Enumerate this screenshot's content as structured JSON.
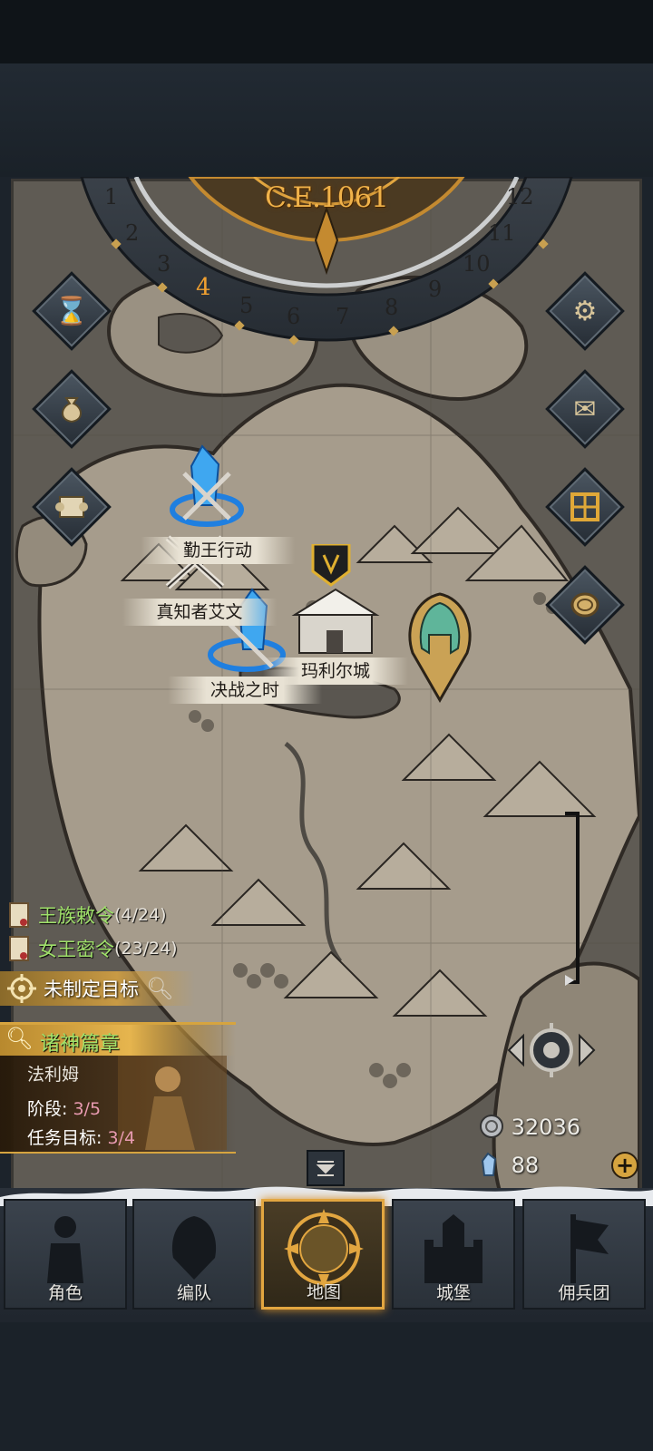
{
  "calendar": {
    "year": "C.E.1061",
    "months": [
      "1",
      "2",
      "3",
      "4",
      "5",
      "6",
      "7",
      "8",
      "9",
      "10",
      "11",
      "12"
    ],
    "current_month": "4"
  },
  "side_buttons_left": [
    {
      "icon": "hourglass-icon"
    },
    {
      "icon": "money-bag-icon"
    },
    {
      "icon": "scroll-icon"
    }
  ],
  "side_buttons_right": [
    {
      "icon": "gear-icon"
    },
    {
      "icon": "mail-icon"
    },
    {
      "icon": "grid-window-icon"
    },
    {
      "icon": "coin-icon"
    }
  ],
  "map": {
    "labels": {
      "battle_top": "勤王行动",
      "battle_mid": "真知者艾文",
      "battle_low": "决战之时",
      "castle": "玛利尔城"
    }
  },
  "quests": [
    {
      "title": "王族敕令",
      "count": "(4/24)"
    },
    {
      "title": "女王密令",
      "count": "(23/24)"
    }
  ],
  "goal": {
    "label": "未制定目标"
  },
  "chapter": {
    "title": "诸神篇章",
    "hero": "法利姆",
    "stage_label": "阶段:",
    "stage_value": "3/5",
    "target_label": "任务目标:",
    "target_value": "3/4"
  },
  "currency": {
    "silver": "32036",
    "crystal": "88"
  },
  "nav": {
    "tabs": [
      "角色",
      "编队",
      "地图",
      "城堡",
      "佣兵团"
    ],
    "active": "地图"
  },
  "colors": {
    "accent_gold": "#e2a640",
    "quest_green": "#9fe06a",
    "progress_pink": "#e89ab0",
    "map_parchment": "#a69c8c"
  }
}
